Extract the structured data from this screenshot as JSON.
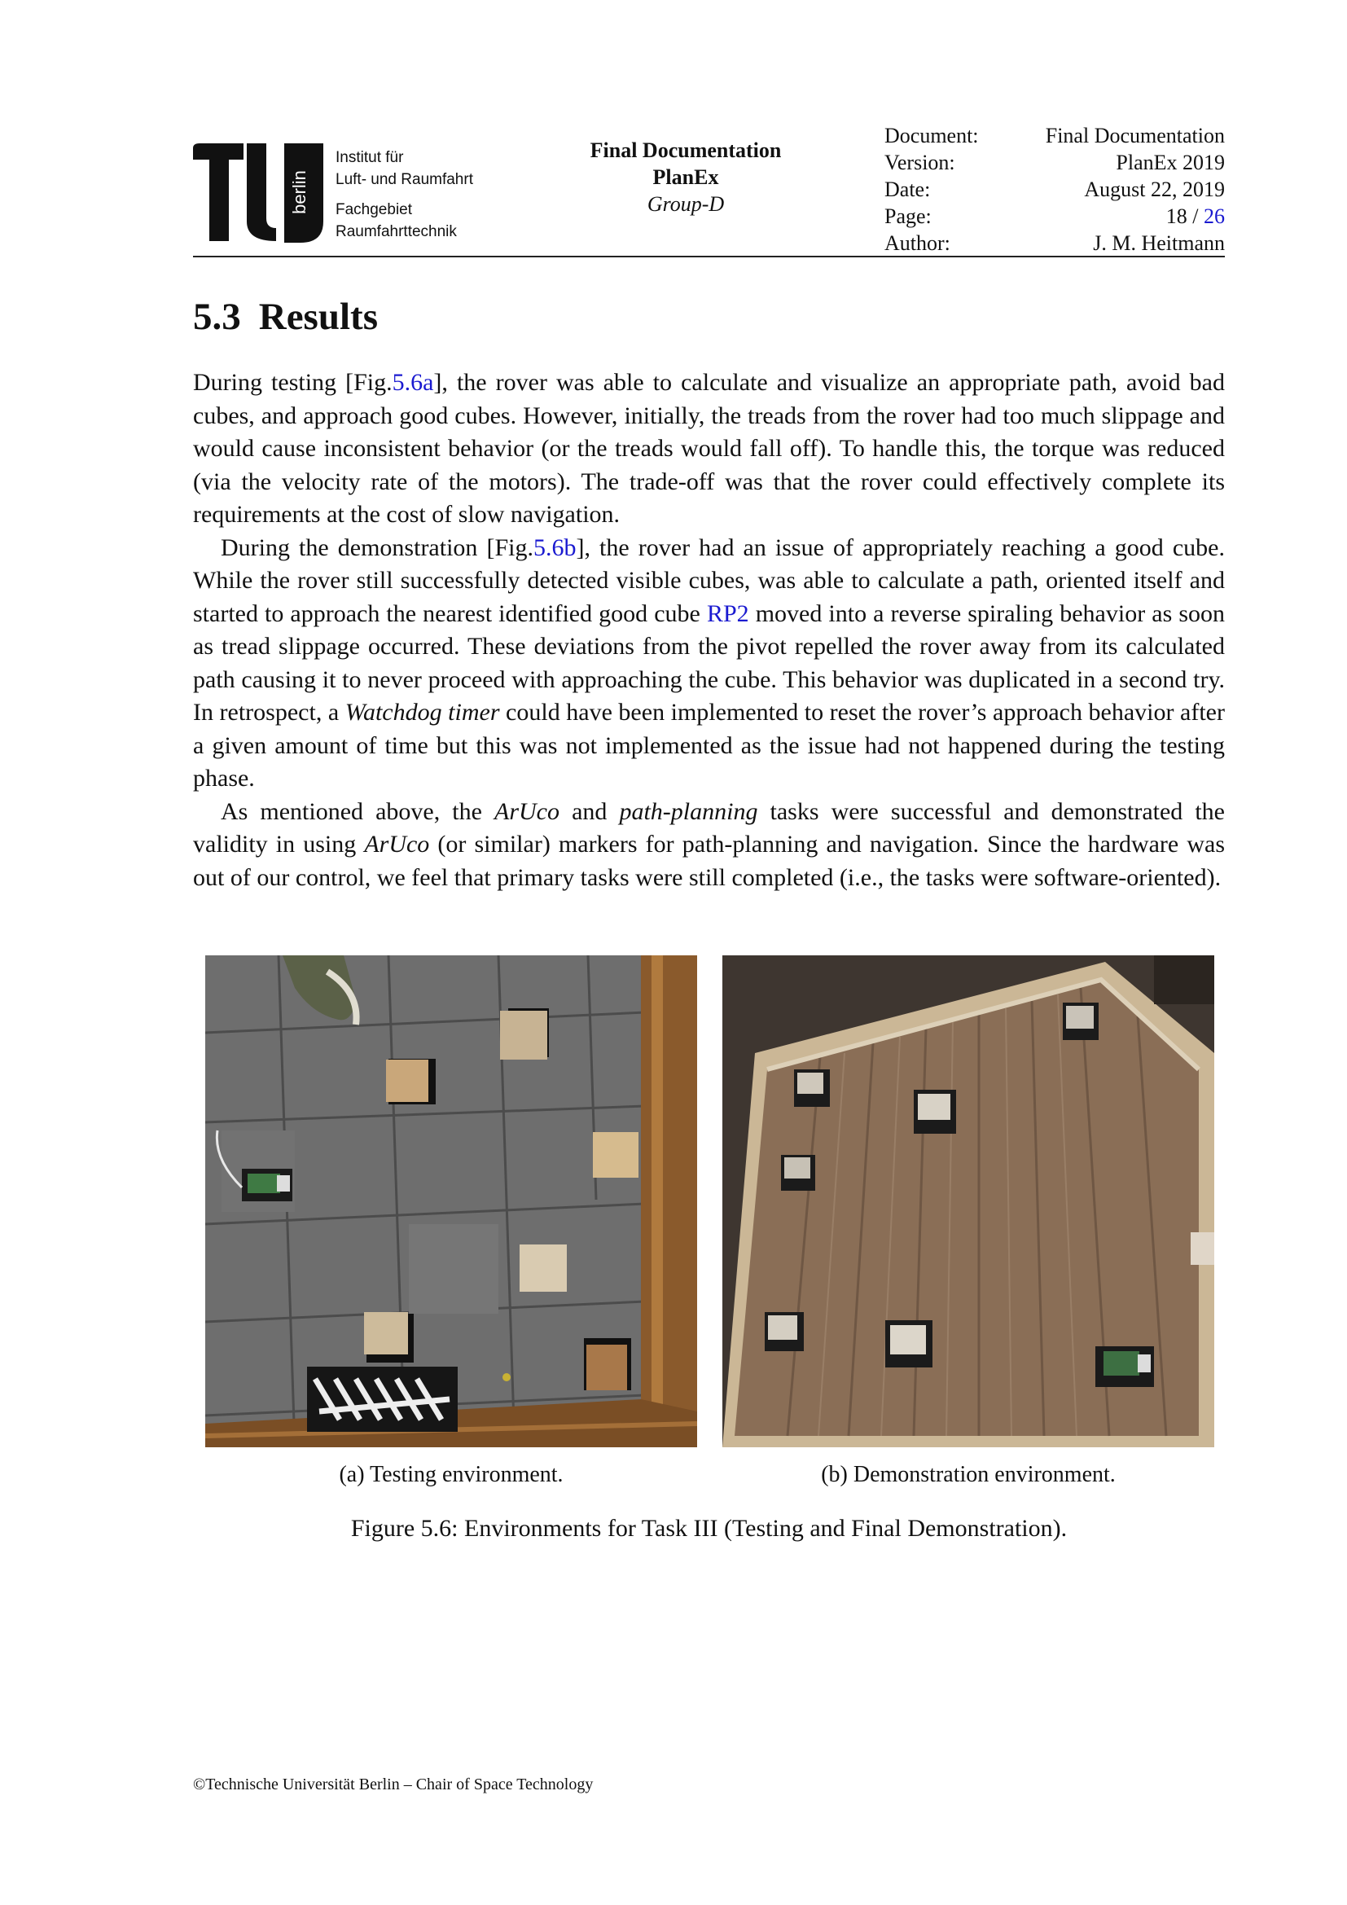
{
  "header": {
    "institute_lines": [
      "Institut für",
      "Luft- und Raumfahrt",
      "Fachgebiet",
      "Raumfahrttechnik"
    ],
    "logo_text": "berlin",
    "center_title": "Final Documentation",
    "center_project": "PlanEx",
    "center_group": "Group-D",
    "meta": {
      "document_label": "Document:",
      "document_value": "Final Documentation",
      "version_label": "Version:",
      "version_value": "PlanEx 2019",
      "date_label": "Date:",
      "date_value": "August 22, 2019",
      "page_label": "Page:",
      "page_current": "18",
      "page_sep": " / ",
      "page_total": "26",
      "author_label": "Author:",
      "author_value": "J. M. Heitmann"
    }
  },
  "section": {
    "number": "5.3",
    "title": "Results"
  },
  "paragraphs": {
    "p1": {
      "t1": "During testing [Fig.",
      "ref": "5.6a",
      "t2": "], the rover was able to calculate and visualize an appropriate path, avoid bad cubes, and approach good cubes. However, initially, the treads from the rover had too much slippage and would cause inconsistent behavior (or the treads would fall off). To handle this, the torque was reduced (via the velocity rate of the motors). The trade-off was that the rover could effectively complete its requirements at the cost of slow navigation."
    },
    "p2": {
      "t1": "During the demonstration [Fig.",
      "ref": "5.6b",
      "t2": "], the rover had an issue of appropriately reaching a good cube. While the rover still successfully detected visible cubes, was able to calculate a path, oriented itself and started to approach the nearest identified good cube ",
      "ref2": "RP2",
      "t3": " moved into a reverse spiraling behavior as soon as tread slippage occurred. These deviations from the pivot repelled the rover away from its calculated path causing it to never proceed with approaching the cube. This behavior was duplicated in a second try. In retrospect, a ",
      "em1": "Watchdog timer",
      "t4": " could have been implemented to reset the rover’s approach behavior after a given amount of time but this was not implemented as the issue had not happened during the testing phase."
    },
    "p3": {
      "t1": "As mentioned above, the ",
      "em1": "ArUco",
      "t2": " and ",
      "em2": "path-planning",
      "t3": " tasks were successful and demonstrated the validity in using ",
      "em3": "ArUco",
      "t4": " (or similar) markers for path-planning and navigation. Since the hardware was out of our control, we feel that primary tasks were still completed (i.e., the tasks were software-oriented)."
    }
  },
  "figure": {
    "sub_a": "(a) Testing environment.",
    "sub_b": "(b) Demonstration environment.",
    "caption": "Figure 5.6: Environments for Task III (Testing and Final Demonstration)."
  },
  "footer": "©Technische Universität Berlin – Chair of Space Technology",
  "colors": {
    "link": "#1a1ad0",
    "text": "#111111"
  }
}
